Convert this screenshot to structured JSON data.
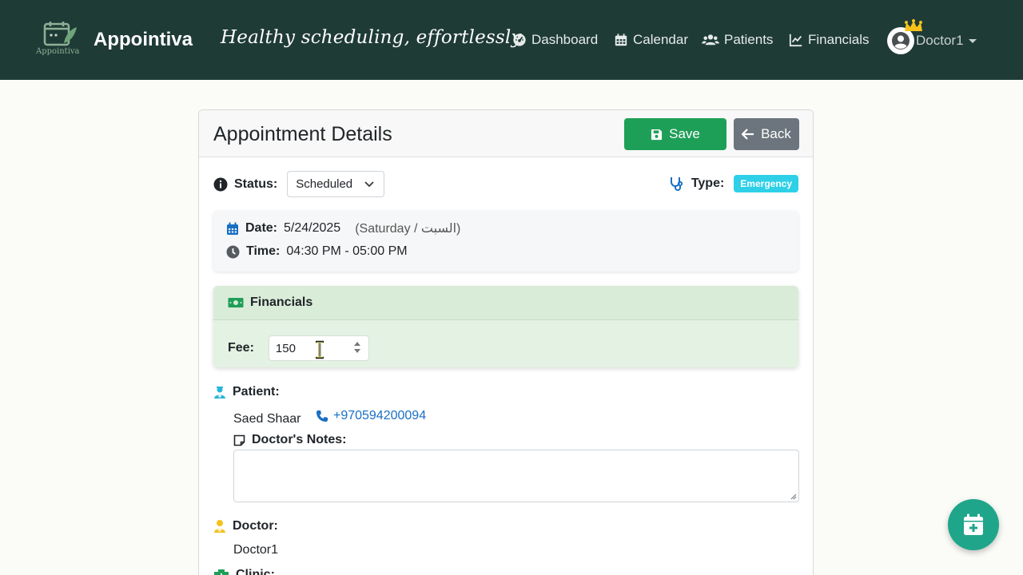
{
  "brand": {
    "name": "Appointiva",
    "logo_text": "Appointiva",
    "tagline": "Healthy scheduling, effortlessly"
  },
  "nav": [
    {
      "icon": "dashboard-icon",
      "label": "Dashboard"
    },
    {
      "icon": "calendar-icon",
      "label": "Calendar"
    },
    {
      "icon": "users-icon",
      "label": "Patients"
    },
    {
      "icon": "chart-line-icon",
      "label": "Financials"
    }
  ],
  "user": {
    "name": "Doctor1"
  },
  "card": {
    "title": "Appointment Details",
    "save_label": "Save",
    "back_label": "Back",
    "status_label": "Status:",
    "status_value": "Scheduled",
    "type_label": "Type:",
    "type_value": "Emergency",
    "date_label": "Date:",
    "date_value": "5/24/2025",
    "day_value": "(Saturday / السبت)",
    "time_label": "Time:",
    "time_value": "04:30 PM - 05:00 PM",
    "financials_title": "Financials",
    "fee_label": "Fee:",
    "fee_value": "150",
    "patient_label": "Patient:",
    "patient_name": "Saed Shaar",
    "patient_phone": "+970594200094",
    "notes_label": "Doctor's Notes:",
    "notes_value": "",
    "doctor_label": "Doctor:",
    "doctor_name": "Doctor1",
    "clinic_label": "Clinic:"
  },
  "colors": {
    "navbar": "#1f3b36",
    "save": "#1e9f57",
    "back": "#6c757d",
    "badge": "#2ed0e8",
    "financials_bg": "#e3f2e2",
    "fab": "#1fa58a",
    "link": "#1a6fc4"
  }
}
